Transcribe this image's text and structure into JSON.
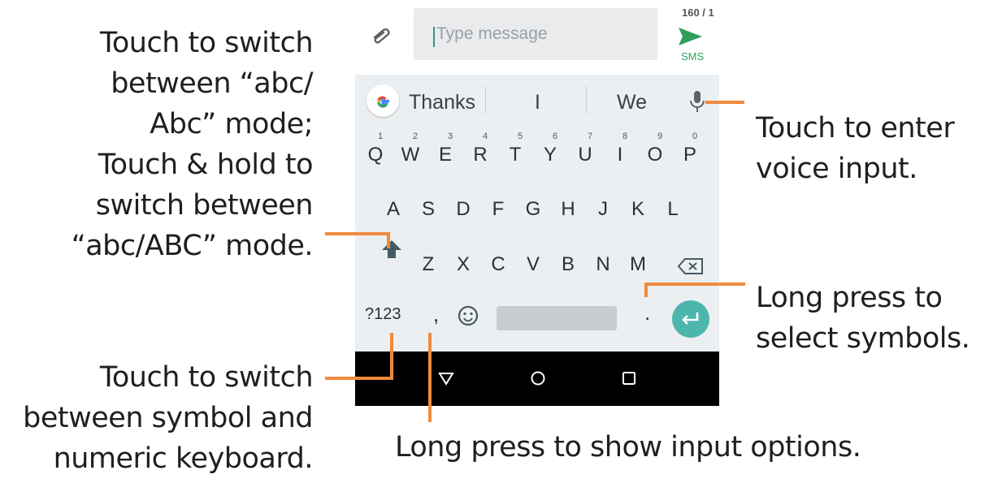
{
  "callouts": {
    "case_mode": [
      "Touch to switch",
      "between “abc/",
      "Abc” mode;",
      "Touch & hold to",
      "switch between",
      "“abc/ABC” mode."
    ],
    "voice_input": [
      "Touch to enter",
      "voice input."
    ],
    "symbols": [
      "Long press to",
      "select symbols."
    ],
    "symbol_numeric": [
      "Touch to switch",
      "between symbol and",
      "numeric keyboard."
    ],
    "input_options": [
      "Long press to show input options."
    ]
  },
  "message_bar": {
    "placeholder": "Type message",
    "counter": "160 / 1",
    "send_label": "SMS"
  },
  "suggestions": [
    "Thanks",
    "I",
    "We"
  ],
  "keyboard": {
    "row1": [
      "Q",
      "W",
      "E",
      "R",
      "T",
      "Y",
      "U",
      "I",
      "O",
      "P"
    ],
    "row1_hints": [
      "1",
      "2",
      "3",
      "4",
      "5",
      "6",
      "7",
      "8",
      "9",
      "0"
    ],
    "row2": [
      "A",
      "S",
      "D",
      "F",
      "G",
      "H",
      "J",
      "K",
      "L"
    ],
    "row3": [
      "Z",
      "X",
      "C",
      "V",
      "B",
      "N",
      "M"
    ],
    "symbols_key": "?123",
    "comma_key": ",",
    "period_key": "."
  },
  "colors": {
    "accent_line": "#ef8a3d",
    "enter_button": "#4db6ac",
    "send_icon": "#2e9e5f",
    "keyboard_bg": "#eceff1",
    "nav_bg": "#000000"
  },
  "icons": {
    "attach": "paperclip-icon",
    "send": "send-arrow-icon",
    "google": "google-g-icon",
    "mic": "microphone-icon",
    "shift": "shift-arrow-icon",
    "backspace": "backspace-icon",
    "emoji": "smiley-icon",
    "enter": "enter-arrow-icon",
    "back": "nav-back-triangle-icon",
    "home": "nav-home-circle-icon",
    "recents": "nav-recents-square-icon"
  }
}
